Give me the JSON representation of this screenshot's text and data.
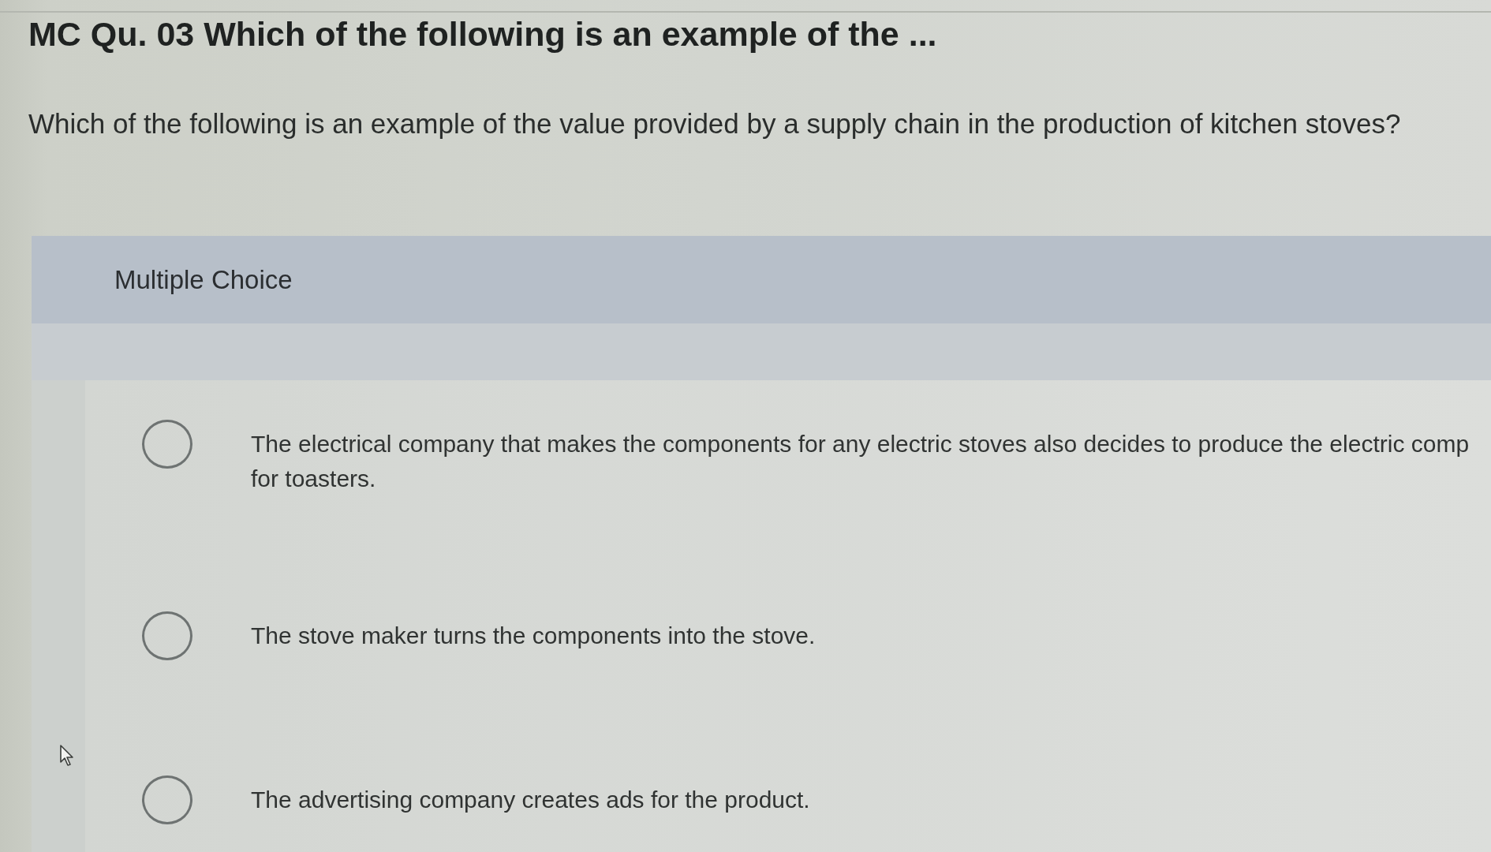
{
  "question_header": {
    "title": "MC Qu. 03 Which of the following is an example of the ..."
  },
  "question": {
    "text": "Which of the following is an example of the value provided by a supply chain in the production of kitchen stoves?"
  },
  "answer_panel": {
    "label": "Multiple Choice",
    "options": [
      {
        "text": "The electrical company that makes the components for any electric stoves also decides to produce the electric comp\nfor toasters.",
        "selected": false
      },
      {
        "text": "The stove maker turns the components into the stove.",
        "selected": false
      },
      {
        "text": "The advertising company creates ads for the product.",
        "selected": false
      }
    ]
  }
}
